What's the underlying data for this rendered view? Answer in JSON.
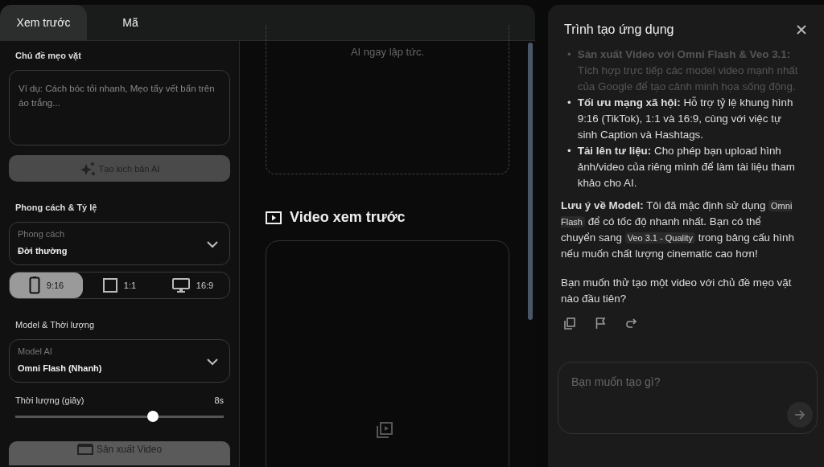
{
  "tabs": [
    {
      "label": "Xem trước",
      "selected": true
    },
    {
      "label": "Mã",
      "selected": false
    }
  ],
  "form": {
    "topic_label": "Chủ đề mẹo vặt",
    "topic_placeholder": "Ví dụ: Cách bóc tỏi nhanh, Mẹo tẩy vết bẩn trên áo trắng...",
    "script_button": {
      "label": "Tạo kịch bản AI",
      "disabled": true
    },
    "style_label": "Phong cách & Tỷ lệ",
    "style_select": {
      "label": "Phong cách",
      "value": "Đời thường"
    },
    "ratios": [
      {
        "label": "9:16",
        "kind": "phone",
        "selected": true
      },
      {
        "label": "1:1",
        "kind": "square",
        "selected": false
      },
      {
        "label": "16:9",
        "kind": "monitor",
        "selected": false
      }
    ],
    "model_label": "Model & Thời lượng",
    "model_select": {
      "label": "Model AI",
      "value": "Omni Flash (Nhanh)"
    },
    "duration_label": "Thời lượng (giây)",
    "duration_value": "8s",
    "duration_slider": {
      "level": 0.66
    },
    "produce_button": {
      "label": "Sản xuất Video",
      "disabled": true
    }
  },
  "preview": {
    "script_hint": "AI ngay lập tức.",
    "heading": "Video xem trước"
  },
  "chat": {
    "title": "Trình tạo ứng dụng",
    "bullets": [
      {
        "marker": "•",
        "text": "**Sản xuất Video với Omni Flash & Veo 3.1:** Tích hợp trực tiếp các model video mạnh nhất của Google để tạo cảnh minh họa sống động.",
        "faded": true
      },
      {
        "marker": "•",
        "text": "**Tối ưu mạng xã hội:** Hỗ trợ tỷ lệ khung hình 9:16 (TikTok), 1:1 và 16:9, cùng với việc tự sinh Caption và Hashtags.",
        "faded": false
      },
      {
        "marker": "•",
        "text": "**Tải lên tư liệu:** Cho phép bạn upload hình ảnh/video của riêng mình để làm tài liệu tham khảo cho AI.",
        "faded": false
      }
    ],
    "note": [
      {
        "kind": "bold",
        "text": "Lưu ý về Model:"
      },
      {
        "kind": "text",
        "text": " Tôi đã mặc định sử dụng "
      },
      {
        "kind": "code",
        "text": "Omni Flash"
      },
      {
        "kind": "text",
        "text": " để có tốc độ nhanh nhất. Bạn có thể chuyển sang "
      },
      {
        "kind": "code",
        "text": "Veo 3.1 - Quality"
      },
      {
        "kind": "text",
        "text": " trong bảng cấu hình nếu muốn chất lượng cinematic cao hơn!"
      }
    ],
    "question": "Bạn muốn thử tạo một video với chủ đề mẹo vặt nào đầu tiên?",
    "input_placeholder": "Bạn muốn tạo gì?"
  }
}
